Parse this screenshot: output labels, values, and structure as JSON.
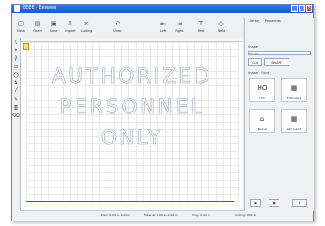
{
  "window": {
    "title": "EEEE - Eeeeee"
  },
  "menu": [
    "File",
    "Edit",
    "View",
    "Object",
    "Help"
  ],
  "toolbar": [
    {
      "label": "New",
      "icon": "new-icon"
    },
    {
      "label": "Open",
      "icon": "open-icon"
    },
    {
      "label": "Save",
      "icon": "save-icon"
    },
    {
      "label": "Import",
      "icon": "import-icon"
    },
    {
      "label": "Cutting",
      "icon": "cut-icon"
    },
    {
      "label": "",
      "icon": "blank-icon"
    },
    {
      "label": "Undo",
      "icon": "undo-icon"
    },
    {
      "label": "",
      "icon": "blank-icon"
    },
    {
      "label": "Left",
      "icon": "align-left-icon"
    },
    {
      "label": "Right",
      "icon": "align-right-icon"
    },
    {
      "label": "Text",
      "icon": "text-icon"
    },
    {
      "label": "Weld",
      "icon": "weld-icon"
    }
  ],
  "right_tabs": [
    "Library",
    "Properties"
  ],
  "right_panel": {
    "section_label": "Shape",
    "input_value": "Rough",
    "button1": "Cut",
    "button2": "SHAPE",
    "filter_labels": [
      "Shape",
      "Font"
    ],
    "thumbs": [
      {
        "glyph": "HO",
        "label": "Hot"
      },
      {
        "glyph": "▦",
        "label": "Embossing"
      },
      {
        "glyph": "⌂",
        "label": "Banner"
      },
      {
        "glyph": "▦",
        "label": "Wall cutout"
      }
    ]
  },
  "canvas": {
    "line1": "AUTHORIZED",
    "line2": "PERSONNEL",
    "line3": "ONLY"
  },
  "status": [
    "Point: 0.00 in, 0.00 in",
    "Material: 0.00 in, 0.00 in",
    "Vinyl: 0.00 in",
    "Cutting: 0.00 in"
  ]
}
